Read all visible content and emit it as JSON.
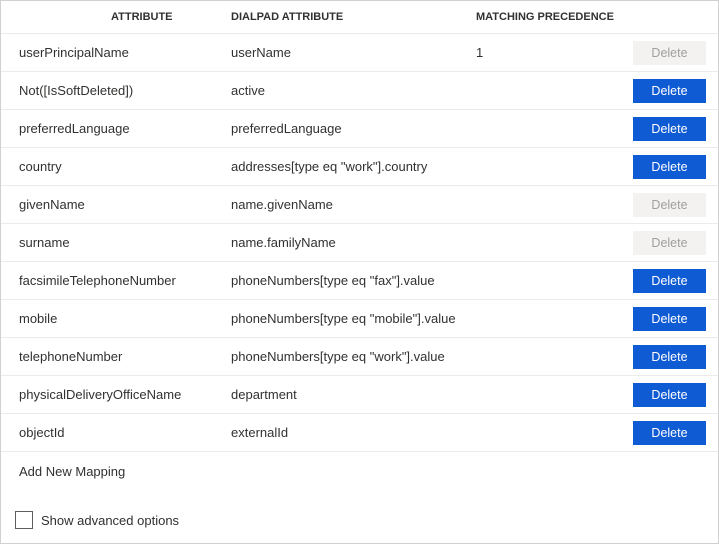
{
  "headers": {
    "attribute": "ATTRIBUTE",
    "dialpad": "DIALPAD ATTRIBUTE",
    "precedence": "MATCHING PRECEDENCE"
  },
  "rows": [
    {
      "attribute": "userPrincipalName",
      "dialpad": "userName",
      "precedence": "1",
      "delete_enabled": false
    },
    {
      "attribute": "Not([IsSoftDeleted])",
      "dialpad": "active",
      "precedence": "",
      "delete_enabled": true
    },
    {
      "attribute": "preferredLanguage",
      "dialpad": "preferredLanguage",
      "precedence": "",
      "delete_enabled": true
    },
    {
      "attribute": "country",
      "dialpad": "addresses[type eq \"work\"].country",
      "precedence": "",
      "delete_enabled": true
    },
    {
      "attribute": "givenName",
      "dialpad": "name.givenName",
      "precedence": "",
      "delete_enabled": false
    },
    {
      "attribute": "surname",
      "dialpad": "name.familyName",
      "precedence": "",
      "delete_enabled": false
    },
    {
      "attribute": "facsimileTelephoneNumber",
      "dialpad": "phoneNumbers[type eq \"fax\"].value",
      "precedence": "",
      "delete_enabled": true
    },
    {
      "attribute": "mobile",
      "dialpad": "phoneNumbers[type eq \"mobile\"].value",
      "precedence": "",
      "delete_enabled": true
    },
    {
      "attribute": "telephoneNumber",
      "dialpad": "phoneNumbers[type eq \"work\"].value",
      "precedence": "",
      "delete_enabled": true
    },
    {
      "attribute": "physicalDeliveryOfficeName",
      "dialpad": "department",
      "precedence": "",
      "delete_enabled": true
    },
    {
      "attribute": "objectId",
      "dialpad": "externalId",
      "precedence": "",
      "delete_enabled": true
    }
  ],
  "labels": {
    "delete": "Delete",
    "add_new": "Add New Mapping",
    "show_advanced": "Show advanced options"
  }
}
